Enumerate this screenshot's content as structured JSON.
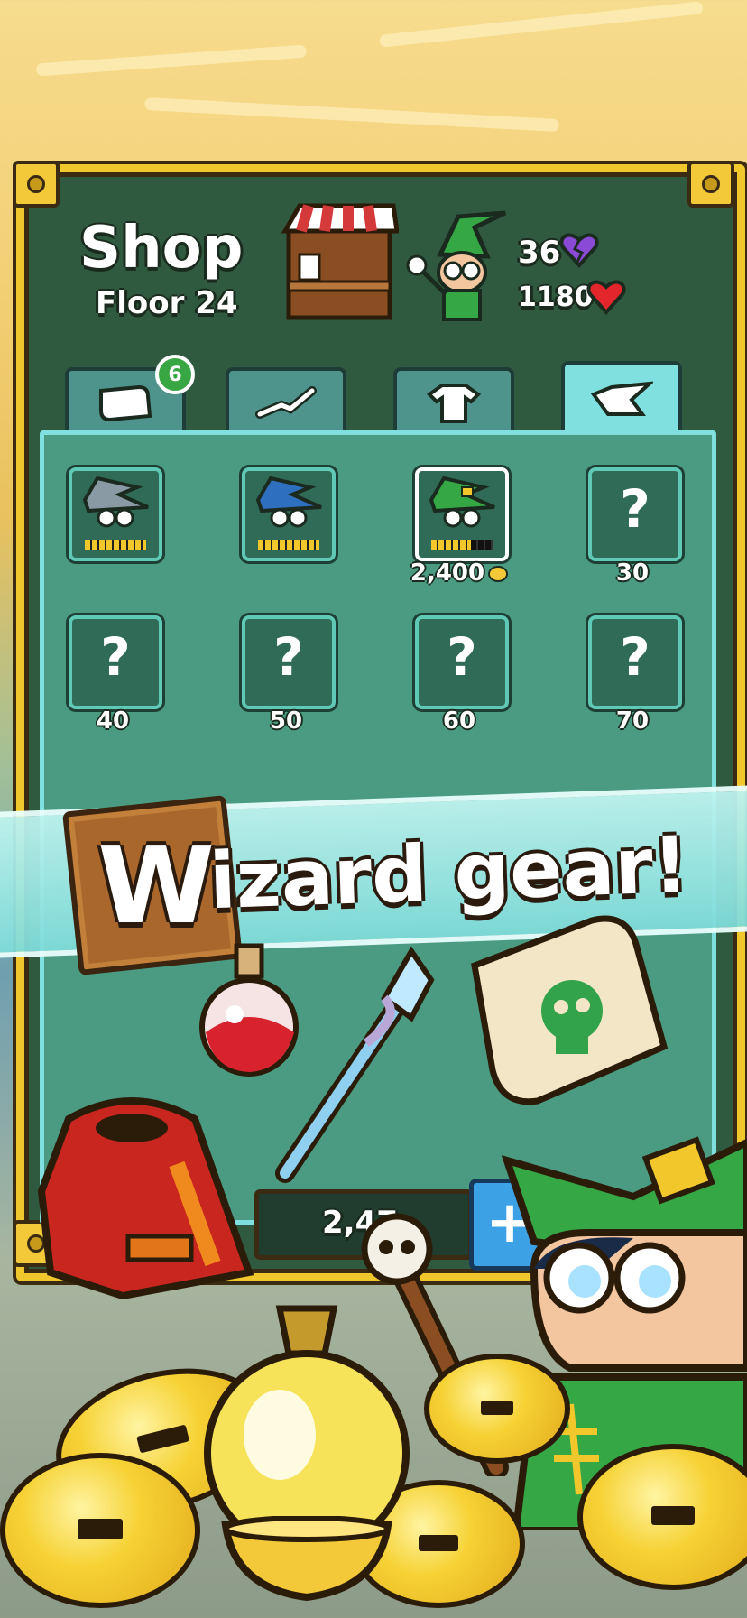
{
  "shop": {
    "title": "Shop",
    "floor": "Floor 24",
    "stats": {
      "purple_hearts": "36",
      "red_hearts": "1180"
    }
  },
  "tabs": [
    {
      "icon": "scroll-icon",
      "badge": "6"
    },
    {
      "icon": "wand-icon"
    },
    {
      "icon": "robe-icon"
    },
    {
      "icon": "wizard-hat-icon",
      "active": true
    }
  ],
  "items": [
    {
      "type": "hat",
      "color": "#8a9aa5",
      "fill": 1.0,
      "label": ""
    },
    {
      "type": "hat",
      "color": "#2f6fbf",
      "fill": 1.0,
      "label": ""
    },
    {
      "type": "hat",
      "color": "#35a745",
      "fill": 0.7,
      "label": "2,400",
      "selected": true
    },
    {
      "type": "locked",
      "mark": "?",
      "label": "30"
    },
    {
      "type": "locked",
      "mark": "?",
      "label": "40"
    },
    {
      "type": "locked",
      "mark": "?",
      "label": "50"
    },
    {
      "type": "locked",
      "mark": "?",
      "label": "60"
    },
    {
      "type": "locked",
      "mark": "?",
      "label": "70"
    }
  ],
  "banner": {
    "first_letter": "W",
    "rest": "izard gear!"
  },
  "footer": {
    "coins": "2,47",
    "plus": "+"
  },
  "colors": {
    "board": "#2f5a3f",
    "frame": "#f0c72c",
    "panel": "#4b9b83",
    "accent": "#7fe0df"
  }
}
